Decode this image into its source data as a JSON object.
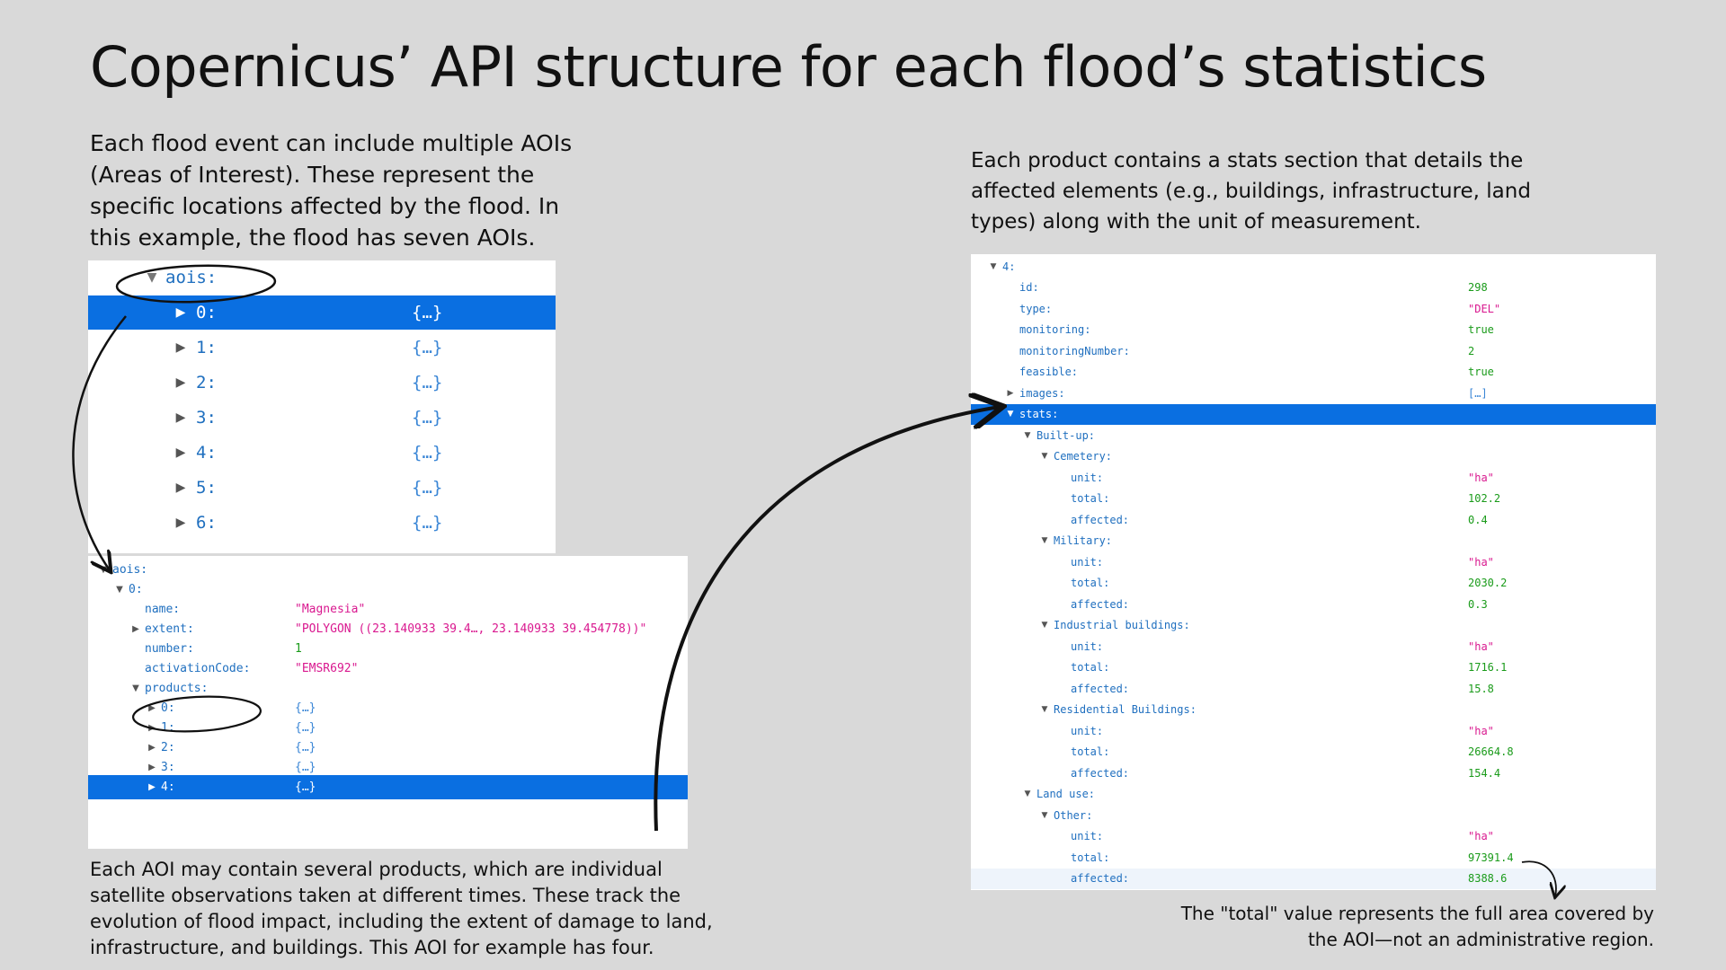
{
  "title": "Copernicus’ API structure for each flood’s statistics",
  "paragraphs": {
    "aois_intro": "Each flood event can include multiple AOIs (Areas of Interest). These represent the specific locations affected by the flood. In this example, the flood has seven AOIs.",
    "stats_intro": "Each product contains a stats section that details the affected elements (e.g., buildings, infrastructure, land types) along with the unit of measurement.",
    "products_note": "Each AOI may contain several products, which are individual satellite observations taken at different times. These track the evolution of flood impact, including the extent of damage to land, infrastructure, and buildings. This AOI for example has four.",
    "total_note": "The \"total\" value represents the full area covered by the AOI—not an administrative region."
  },
  "aois_panel": {
    "header": "aois:",
    "items": [
      {
        "key": "0:",
        "value": "{…}",
        "selected": true
      },
      {
        "key": "1:",
        "value": "{…}",
        "selected": false
      },
      {
        "key": "2:",
        "value": "{…}",
        "selected": false
      },
      {
        "key": "3:",
        "value": "{…}",
        "selected": false
      },
      {
        "key": "4:",
        "value": "{…}",
        "selected": false
      },
      {
        "key": "5:",
        "value": "{…}",
        "selected": false
      },
      {
        "key": "6:",
        "value": "{…}",
        "selected": false
      }
    ]
  },
  "aoi_detail_panel": {
    "rows": [
      {
        "depth": 0,
        "twisty": "down",
        "key": "aois:",
        "value": "",
        "vtype": ""
      },
      {
        "depth": 1,
        "twisty": "down",
        "key": "0:",
        "value": "",
        "vtype": ""
      },
      {
        "depth": 2,
        "twisty": "",
        "key": "name:",
        "value": "\"Magnesia\"",
        "vtype": "str"
      },
      {
        "depth": 2,
        "twisty": "right",
        "key": "extent:",
        "value": "\"POLYGON ((23.140933 39.4…, 23.140933 39.454778))\"",
        "vtype": "str"
      },
      {
        "depth": 2,
        "twisty": "",
        "key": "number:",
        "value": "1",
        "vtype": "num"
      },
      {
        "depth": 2,
        "twisty": "",
        "key": "activationCode:",
        "value": "\"EMSR692\"",
        "vtype": "str"
      },
      {
        "depth": 2,
        "twisty": "down",
        "key": "products:",
        "value": "",
        "vtype": ""
      },
      {
        "depth": 3,
        "twisty": "right",
        "key": "0:",
        "value": "{…}",
        "vtype": "obj"
      },
      {
        "depth": 3,
        "twisty": "right",
        "key": "1:",
        "value": "{…}",
        "vtype": "obj"
      },
      {
        "depth": 3,
        "twisty": "right",
        "key": "2:",
        "value": "{…}",
        "vtype": "obj"
      },
      {
        "depth": 3,
        "twisty": "right",
        "key": "3:",
        "value": "{…}",
        "vtype": "obj"
      },
      {
        "depth": 3,
        "twisty": "right",
        "key": "4:",
        "value": "{…}",
        "vtype": "obj",
        "selected": true
      }
    ]
  },
  "stats_panel": {
    "rows": [
      {
        "depth": 0,
        "twisty": "down",
        "key": "4:",
        "value": "",
        "vtype": ""
      },
      {
        "depth": 1,
        "twisty": "",
        "key": "id:",
        "value": "298",
        "vtype": "num"
      },
      {
        "depth": 1,
        "twisty": "",
        "key": "type:",
        "value": "\"DEL\"",
        "vtype": "str"
      },
      {
        "depth": 1,
        "twisty": "",
        "key": "monitoring:",
        "value": "true",
        "vtype": "bool"
      },
      {
        "depth": 1,
        "twisty": "",
        "key": "monitoringNumber:",
        "value": "2",
        "vtype": "num"
      },
      {
        "depth": 1,
        "twisty": "",
        "key": "feasible:",
        "value": "true",
        "vtype": "bool"
      },
      {
        "depth": 1,
        "twisty": "right",
        "key": "images:",
        "value": "[…]",
        "vtype": "obj"
      },
      {
        "depth": 1,
        "twisty": "down",
        "key": "stats:",
        "value": "",
        "vtype": "",
        "selected": true
      },
      {
        "depth": 2,
        "twisty": "down",
        "key": "Built-up:",
        "value": "",
        "vtype": ""
      },
      {
        "depth": 3,
        "twisty": "down",
        "key": "Cemetery:",
        "value": "",
        "vtype": ""
      },
      {
        "depth": 4,
        "twisty": "",
        "key": "unit:",
        "value": "\"ha\"",
        "vtype": "str"
      },
      {
        "depth": 4,
        "twisty": "",
        "key": "total:",
        "value": "102.2",
        "vtype": "num"
      },
      {
        "depth": 4,
        "twisty": "",
        "key": "affected:",
        "value": "0.4",
        "vtype": "num"
      },
      {
        "depth": 3,
        "twisty": "down",
        "key": "Military:",
        "value": "",
        "vtype": ""
      },
      {
        "depth": 4,
        "twisty": "",
        "key": "unit:",
        "value": "\"ha\"",
        "vtype": "str"
      },
      {
        "depth": 4,
        "twisty": "",
        "key": "total:",
        "value": "2030.2",
        "vtype": "num"
      },
      {
        "depth": 4,
        "twisty": "",
        "key": "affected:",
        "value": "0.3",
        "vtype": "num"
      },
      {
        "depth": 3,
        "twisty": "down",
        "key": "Industrial buildings:",
        "value": "",
        "vtype": ""
      },
      {
        "depth": 4,
        "twisty": "",
        "key": "unit:",
        "value": "\"ha\"",
        "vtype": "str"
      },
      {
        "depth": 4,
        "twisty": "",
        "key": "total:",
        "value": "1716.1",
        "vtype": "num"
      },
      {
        "depth": 4,
        "twisty": "",
        "key": "affected:",
        "value": "15.8",
        "vtype": "num"
      },
      {
        "depth": 3,
        "twisty": "down",
        "key": "Residential Buildings:",
        "value": "",
        "vtype": ""
      },
      {
        "depth": 4,
        "twisty": "",
        "key": "unit:",
        "value": "\"ha\"",
        "vtype": "str"
      },
      {
        "depth": 4,
        "twisty": "",
        "key": "total:",
        "value": "26664.8",
        "vtype": "num"
      },
      {
        "depth": 4,
        "twisty": "",
        "key": "affected:",
        "value": "154.4",
        "vtype": "num"
      },
      {
        "depth": 2,
        "twisty": "down",
        "key": "Land use:",
        "value": "",
        "vtype": ""
      },
      {
        "depth": 3,
        "twisty": "down",
        "key": "Other:",
        "value": "",
        "vtype": ""
      },
      {
        "depth": 4,
        "twisty": "",
        "key": "unit:",
        "value": "\"ha\"",
        "vtype": "str"
      },
      {
        "depth": 4,
        "twisty": "",
        "key": "total:",
        "value": "97391.4",
        "vtype": "num"
      },
      {
        "depth": 4,
        "twisty": "",
        "key": "affected:",
        "value": "8388.6",
        "vtype": "num",
        "highlighted": true
      }
    ]
  }
}
